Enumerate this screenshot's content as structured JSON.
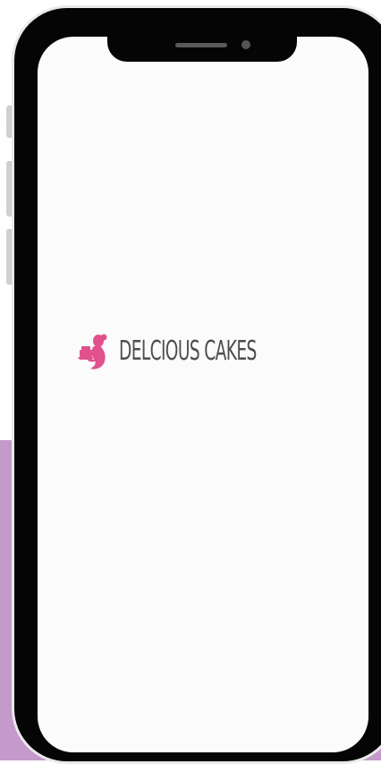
{
  "app": {
    "brand_name": "DELCIOUS CAKES"
  },
  "colors": {
    "background_top": "#ffffff",
    "background_bottom": "#c39ac9",
    "logo_accent": "#e0518e",
    "logo_text": "#4e4e4e",
    "phone_body": "#050505",
    "screen": "#fbfbfb"
  },
  "icons": {
    "logo_mark": "woman-holding-cake-icon"
  }
}
